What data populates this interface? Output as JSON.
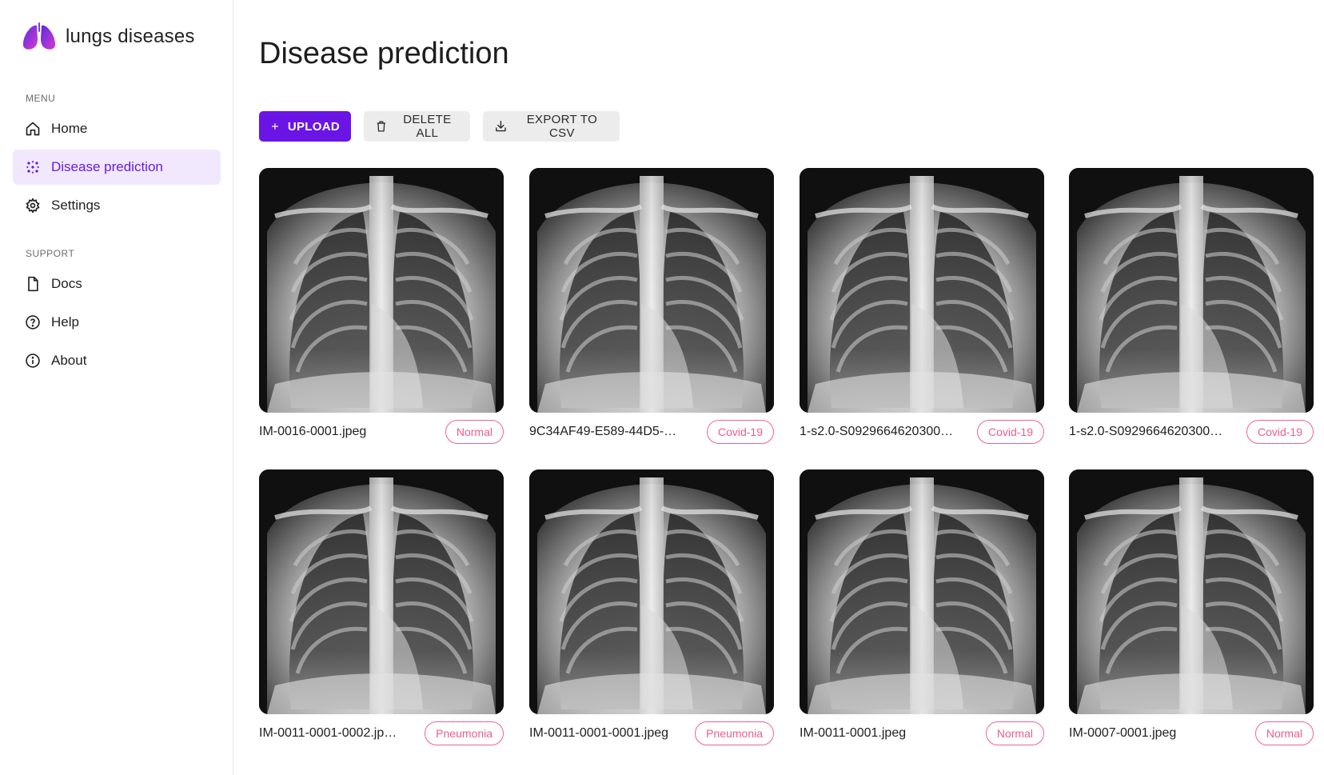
{
  "app": {
    "brand_name": "lungs diseases",
    "accent_color": "#6a14e6"
  },
  "sidebar": {
    "menu_label": "MENU",
    "menu_items": [
      {
        "label": "Home",
        "icon": "home-icon"
      },
      {
        "label": "Disease prediction",
        "icon": "scatter-dots-icon",
        "active": true
      },
      {
        "label": "Settings",
        "icon": "gear-icon"
      }
    ],
    "support_label": "SUPPORT",
    "support_items": [
      {
        "label": "Docs",
        "icon": "document-icon"
      },
      {
        "label": "Help",
        "icon": "help-circle-icon"
      },
      {
        "label": "About",
        "icon": "info-circle-icon"
      }
    ]
  },
  "main": {
    "title": "Disease prediction",
    "toolbar": {
      "upload_label": "UPLOAD",
      "delete_all_label": "DELETE ALL",
      "export_label": "EXPORT TO CSV"
    },
    "images": [
      {
        "filename": "IM-0016-0001.jpeg",
        "label": "Normal"
      },
      {
        "filename": "9C34AF49-E589-44D5-…",
        "label": "Covid-19"
      },
      {
        "filename": "1-s2.0-S0929664620300…",
        "label": "Covid-19"
      },
      {
        "filename": "1-s2.0-S0929664620300…",
        "label": "Covid-19"
      },
      {
        "filename": "IM-0011-0001-0002.jp…",
        "label": "Pneumonia"
      },
      {
        "filename": "IM-0011-0001-0001.jpeg",
        "label": "Pneumonia"
      },
      {
        "filename": "IM-0011-0001.jpeg",
        "label": "Normal"
      },
      {
        "filename": "IM-0007-0001.jpeg",
        "label": "Normal"
      }
    ]
  }
}
